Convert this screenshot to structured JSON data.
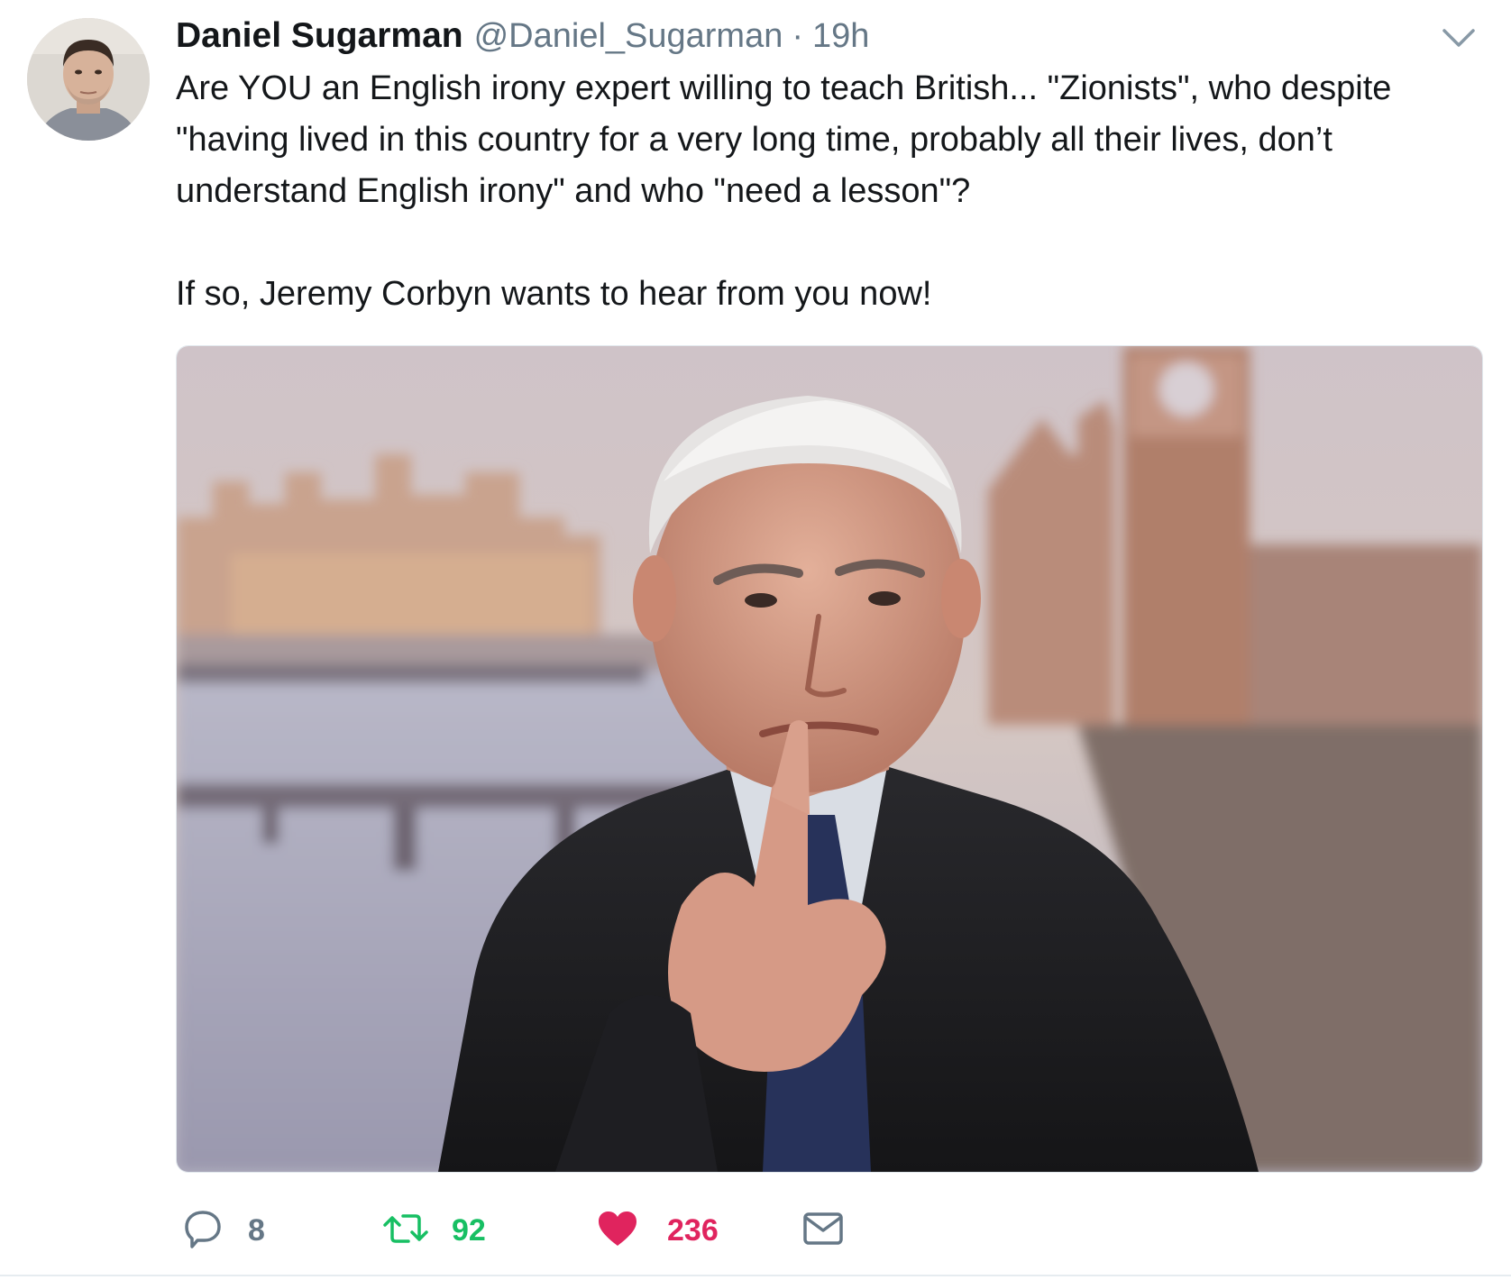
{
  "tweet": {
    "author": {
      "name": "Daniel Sugarman",
      "handle": "@Daniel_Sugarman",
      "separator": "·",
      "time": "19h",
      "avatar_icon": "user-avatar"
    },
    "text": {
      "paragraph1": "Are YOU an English irony expert willing to teach British... \"Zionists\", who despite \"having lived in this country for a very long time, probably all their lives, don’t understand English irony\" and who \"need a lesson\"?",
      "paragraph2": "If so, Jeremy Corbyn wants to hear from you now!"
    },
    "media": {
      "icon": "photo-man-pointing-westminster"
    },
    "actions": {
      "reply": {
        "icon": "reply-icon",
        "count": "8",
        "color": "#657786"
      },
      "retweet": {
        "icon": "retweet-icon",
        "count": "92",
        "color": "#17bf63"
      },
      "like": {
        "icon": "heart-icon",
        "count": "236",
        "color": "#e0245e",
        "liked": true
      },
      "dm": {
        "icon": "envelope-icon"
      }
    },
    "menu": {
      "icon": "chevron-down-icon"
    }
  }
}
